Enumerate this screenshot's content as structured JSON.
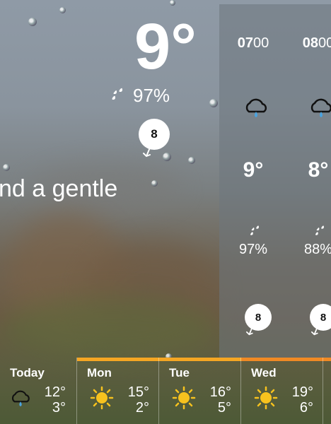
{
  "current": {
    "temperature": "9°",
    "humidity": "97%",
    "wind_speed": "8",
    "summary": "nd a gentle"
  },
  "hourly": [
    {
      "time_bold": "07",
      "time_rest": "00",
      "icon": "cloud-rain-icon",
      "temperature": "9°",
      "humidity": "97%",
      "wind_speed": "8"
    },
    {
      "time_bold": "08",
      "time_rest": "00",
      "icon": "cloud-rain-icon",
      "temperature": "8°",
      "humidity": "88%",
      "wind_speed": "8"
    }
  ],
  "daily": [
    {
      "day": "Today",
      "icon": "cloud-rain-icon",
      "high": "12°",
      "low": "3°",
      "bar_color": ""
    },
    {
      "day": "Mon",
      "icon": "sun-icon",
      "high": "15°",
      "low": "2°",
      "bar_color": "#f5a623"
    },
    {
      "day": "Tue",
      "icon": "sun-icon",
      "high": "16°",
      "low": "5°",
      "bar_color": "#f5a623"
    },
    {
      "day": "Wed",
      "icon": "sun-icon",
      "high": "19°",
      "low": "6°",
      "bar_color": "#f08a24"
    }
  ],
  "colors": {
    "sun": "#f7c21e",
    "rain": "#4aa3e0"
  }
}
